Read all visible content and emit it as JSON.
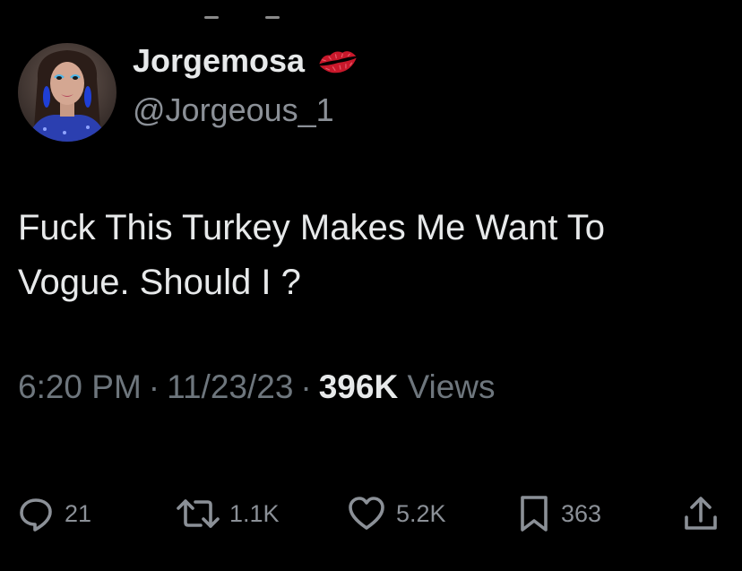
{
  "author": {
    "display_name": "Jorgemosa",
    "handle": "@Jorgeous_1",
    "avatar": "avatar",
    "name_emoji": "kiss-mark-icon"
  },
  "tweet": {
    "text": "Fuck This Turkey Makes Me Want To Vogue. Should I ?"
  },
  "meta": {
    "time": "6:20 PM",
    "separator": "·",
    "date": "11/23/23",
    "views_count": "396K",
    "views_label": "Views"
  },
  "actions": {
    "replies": {
      "icon": "reply-icon",
      "count": "21"
    },
    "retweets": {
      "icon": "retweet-icon",
      "count": "1.1K"
    },
    "likes": {
      "icon": "heart-icon",
      "count": "5.2K"
    },
    "bookmarks": {
      "icon": "bookmark-icon",
      "count": "363"
    },
    "share": {
      "icon": "share-icon"
    }
  },
  "colors": {
    "background": "#000000",
    "primary_text": "#e7e9ea",
    "secondary_text": "#8b9097",
    "emoji_red": "#c9182b"
  }
}
